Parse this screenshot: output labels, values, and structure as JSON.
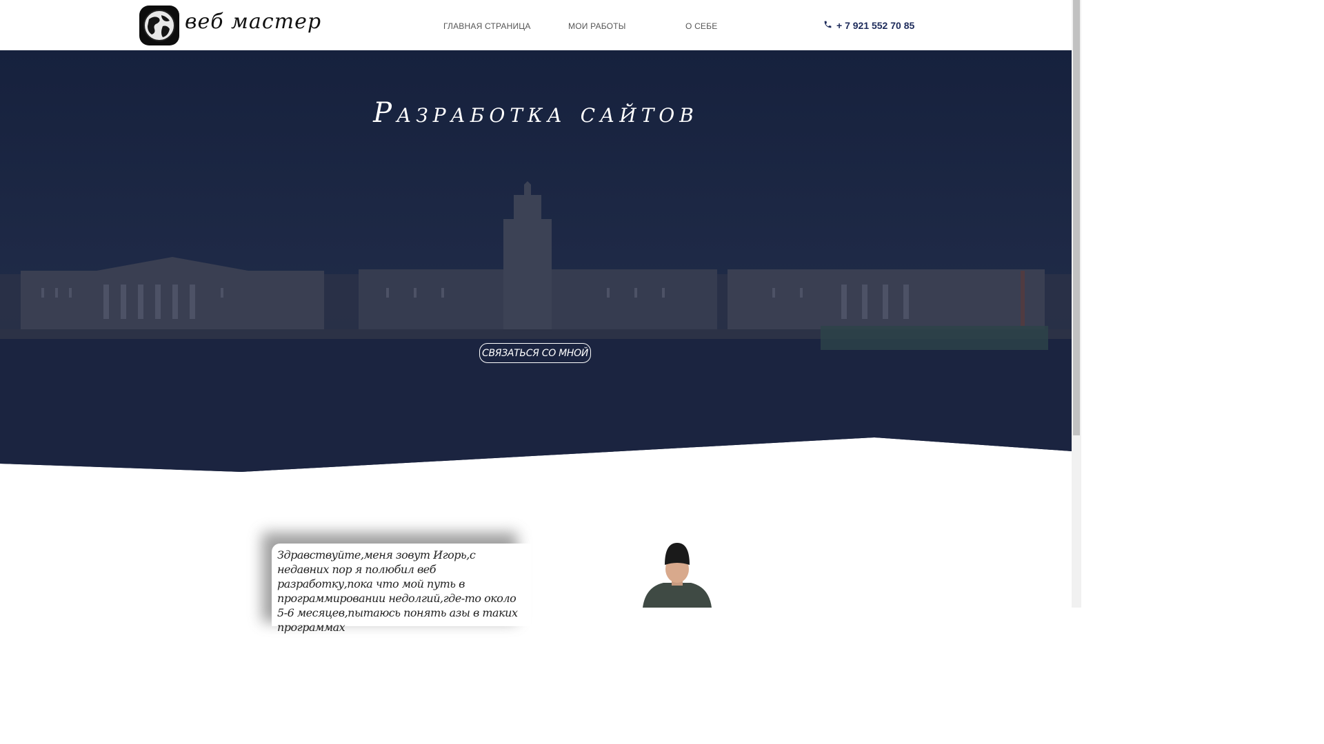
{
  "header": {
    "logo_text": "веб мастер",
    "nav": [
      {
        "label": "ГЛАВНАЯ СТРАНИЦА"
      },
      {
        "label": "МОИ РАБОТЫ"
      },
      {
        "label": "О СЕБЕ"
      }
    ],
    "phone": "+ 7 921 552 70 85"
  },
  "hero": {
    "title": "Разработка сайтов",
    "cta_label": "СВЯЗАТЬСЯ СО МНОЙ"
  },
  "about": {
    "text": "Здравствуйте,меня зовут Игорь,с недавних пор я полюбил веб разработку,пока что мой путь в программировании недолгий,где-то около 5-6 месяцев,пытаюсь понять азы в таких программах"
  },
  "colors": {
    "hero_overlay": "#1c2745",
    "accent": "#1c2a5a"
  },
  "icons": [
    "globe-logo-icon",
    "phone-icon"
  ]
}
